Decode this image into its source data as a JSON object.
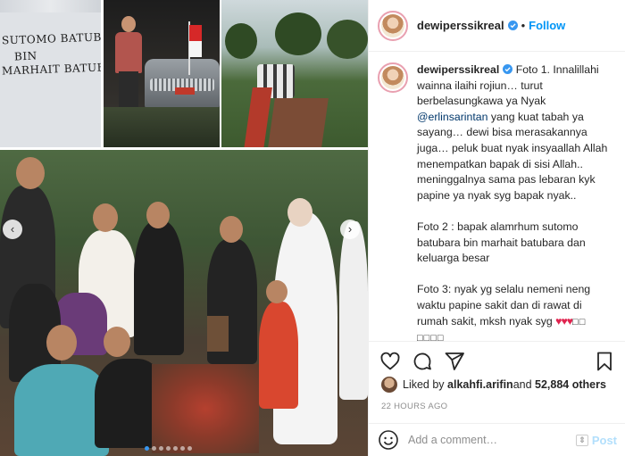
{
  "post": {
    "username": "dewiperssikreal",
    "follow_label": "Follow",
    "separator": "•",
    "verified_icon": "verified-badge-icon"
  },
  "media": {
    "handwritten_lines": [
      "SUTOMO BATUBARA",
      "BIN",
      "MARHAIT BATUBARA"
    ],
    "carousel_total": 7,
    "carousel_active_index": 0,
    "nav_left": "‹",
    "nav_right": "›"
  },
  "caption": {
    "username": "dewiperssikreal",
    "foto1_a": " Foto 1. Innalillahi wainna ilaihi rojiun… turut berbelasungkawa ya Nyak ",
    "mention": "@erlinsarintan",
    "foto1_b": " yang kuat tabah ya sayang… dewi bisa merasakannya juga… peluk buat nyak insyaallah Allah menempatkan bapak di sisi Allah.. meninggalnya sama pas lebaran kyk papine ya nyak syg bapak nyak..",
    "foto2": "Foto 2 : bapak alamrhum sutomo batubara bin marhait batubara dan keluarga besar",
    "foto3": "Foto 3: nyak yg selalu nemeni neng waktu papine sakit dan di rawat di rumah sakit, mksh nyak syg ",
    "hearts": "♥♥♥",
    "trailing_boxes": "□□ □□□□"
  },
  "likes": {
    "prefix": "Liked by ",
    "user": "alkahfi.arifin",
    "middle": " and ",
    "count": "52,884 others"
  },
  "timestamp": "22 HOURS AGO",
  "comment": {
    "placeholder": "Add a comment…",
    "post_label": "Post",
    "scroll_glyph": "⇕"
  },
  "colors": {
    "link_blue": "#0095f6",
    "mention_blue": "#00376b",
    "heart_red": "#e0244f",
    "muted_gray": "#8e8e8e"
  }
}
